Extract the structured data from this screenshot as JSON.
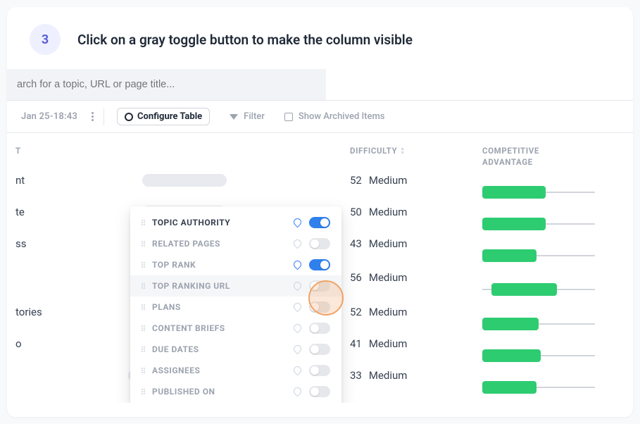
{
  "step": {
    "number": "3",
    "title": "Click on a gray toggle button to make the column visible"
  },
  "search": {
    "placeholder": "arch for a topic, URL or page title..."
  },
  "toolbar": {
    "date": "Jan 25-18:43",
    "configure": "Configure Table",
    "filter": "Filter",
    "archived": "Show Archived Items"
  },
  "columns": {
    "left_prefix": "T",
    "diff": "DIFFICULTY",
    "adv_line1": "COMPETITIVE",
    "adv_line2": "ADVANTAGE"
  },
  "rows": [
    {
      "name": "nt",
      "diff": 52,
      "label": "Medium",
      "bar": 56
    },
    {
      "name": "te",
      "diff": 50,
      "label": "Medium",
      "bar": 56
    },
    {
      "name": "ss",
      "diff": 43,
      "label": "Medium",
      "bar": 48
    },
    {
      "name": "",
      "diff": 56,
      "label": "Medium",
      "bar": 58,
      "offset": true
    },
    {
      "name": "tories",
      "diff": 52,
      "label": "Medium",
      "bar": 50
    },
    {
      "name": "o",
      "diff": 41,
      "label": "Medium",
      "bar": 52
    },
    {
      "name": "",
      "diff": 33,
      "label": "Medium",
      "bar": 48,
      "badge": "45",
      "circle": "17",
      "circleColor": "orange"
    }
  ],
  "dropdown": [
    {
      "label": "TOPIC AUTHORITY",
      "pin": "blue",
      "on": true,
      "active": true
    },
    {
      "label": "RELATED PAGES",
      "pin": "gray",
      "on": false
    },
    {
      "label": "TOP RANK",
      "pin": "blue",
      "on": true
    },
    {
      "label": "TOP RANKING URL",
      "pin": "gray",
      "on": false,
      "highlighted": true
    },
    {
      "label": "PLANS",
      "pin": "gray",
      "on": false
    },
    {
      "label": "CONTENT BRIEFS",
      "pin": "gray",
      "on": false
    },
    {
      "label": "DUE DATES",
      "pin": "gray",
      "on": false
    },
    {
      "label": "ASSIGNEES",
      "pin": "gray",
      "on": false
    },
    {
      "label": "PUBLISHED ON",
      "pin": "gray",
      "on": false
    }
  ]
}
